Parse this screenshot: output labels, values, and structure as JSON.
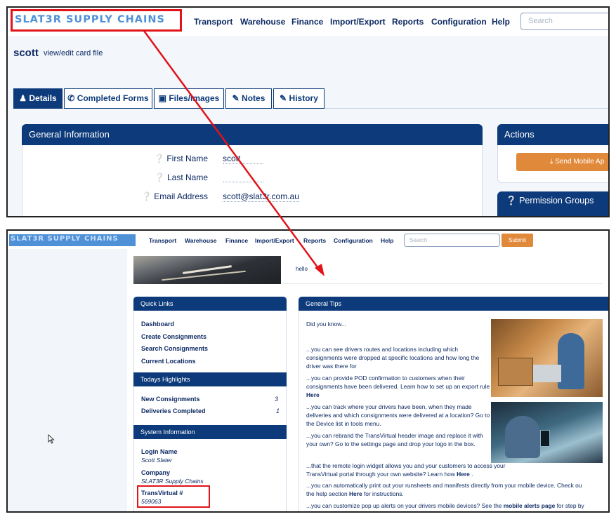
{
  "top": {
    "logo": "SLAT3R SUPPLY CHAINS",
    "nav": [
      "Transport",
      "Warehouse",
      "Finance",
      "Import/Export",
      "Reports",
      "Configuration",
      "Help"
    ],
    "search_placeholder": "Search",
    "user": "scott",
    "subtitle": "view/edit card file",
    "tabs": [
      "Details",
      "Completed Forms",
      "Files/Images",
      "Notes",
      "History"
    ],
    "general_info_title": "General Information",
    "fields": [
      {
        "label": "First Name",
        "value": "scott"
      },
      {
        "label": "Last Name",
        "value": ""
      },
      {
        "label": "Email Address",
        "value": "scott@slat3r.com.au"
      }
    ],
    "actions_title": "Actions",
    "send_button": "Send Mobile Ap",
    "permission_title": "Permission Groups"
  },
  "bottom": {
    "logo": "SLAT3R SUPPLY CHAINS",
    "nav": [
      "Transport",
      "Warehouse",
      "Finance",
      "Import/Export",
      "Reports",
      "Configuration",
      "Help"
    ],
    "search_placeholder": "Search",
    "submit": "Submit",
    "hello": "hello",
    "quick_links_title": "Quick Links",
    "quick_links": [
      "Dashboard",
      "Create Consignments",
      "Search Consignments",
      "Current Locations"
    ],
    "highlights_title": "Todays Highlights",
    "highlights": [
      {
        "label": "New Consignments",
        "count": "3"
      },
      {
        "label": "Deliveries Completed",
        "count": "1"
      }
    ],
    "sysinfo_title": "System Information",
    "login_name_label": "Login Name",
    "login_name": "Scott Slater",
    "company_label": "Company",
    "company": "SLAT3R Supply Chains",
    "transvirtual_label": "TransVirtual #",
    "transvirtual": "569063",
    "tips_title": "General Tips",
    "did_you_know": "Did you know...",
    "tips": {
      "t1": "...you can see drivers routes and locations including which consignments were dropped at specific locations and how long the driver was there for",
      "t2a": "...you can provide POD confirmation to customers when their consignments have been delivered. Learn how to set up an export rule ",
      "t2b": "Here",
      "t3": "...you can track where your drivers have been, when they made deliveries and which consignments were delivered at a location? Go to the Device list in tools menu.",
      "t4": "...you can rebrand the TransVirtual header image and replace it with your own? Go to the settings page and drop your logo in the box.",
      "t5a": "...that the remote login widget allows you and your customers to access your TransVirtual portal through your own website? Learn how ",
      "t5b": "Here",
      "t5c": " .",
      "t6a": "...you can automatically print out your runsheets and manifests directly from your mobile device. Check ou",
      "t6b": "the help section ",
      "t6c": "Here",
      "t6d": " for instructions.",
      "t7a": "...you can customize pop up alerts on your drivers mobile devices? See the ",
      "t7b": "mobile alerts page",
      "t7c": " for step by"
    }
  },
  "colors": {
    "navy": "#0d3a7a",
    "accent": "#e1893a",
    "annotation": "#e0141a",
    "logo": "#4f91d6"
  }
}
